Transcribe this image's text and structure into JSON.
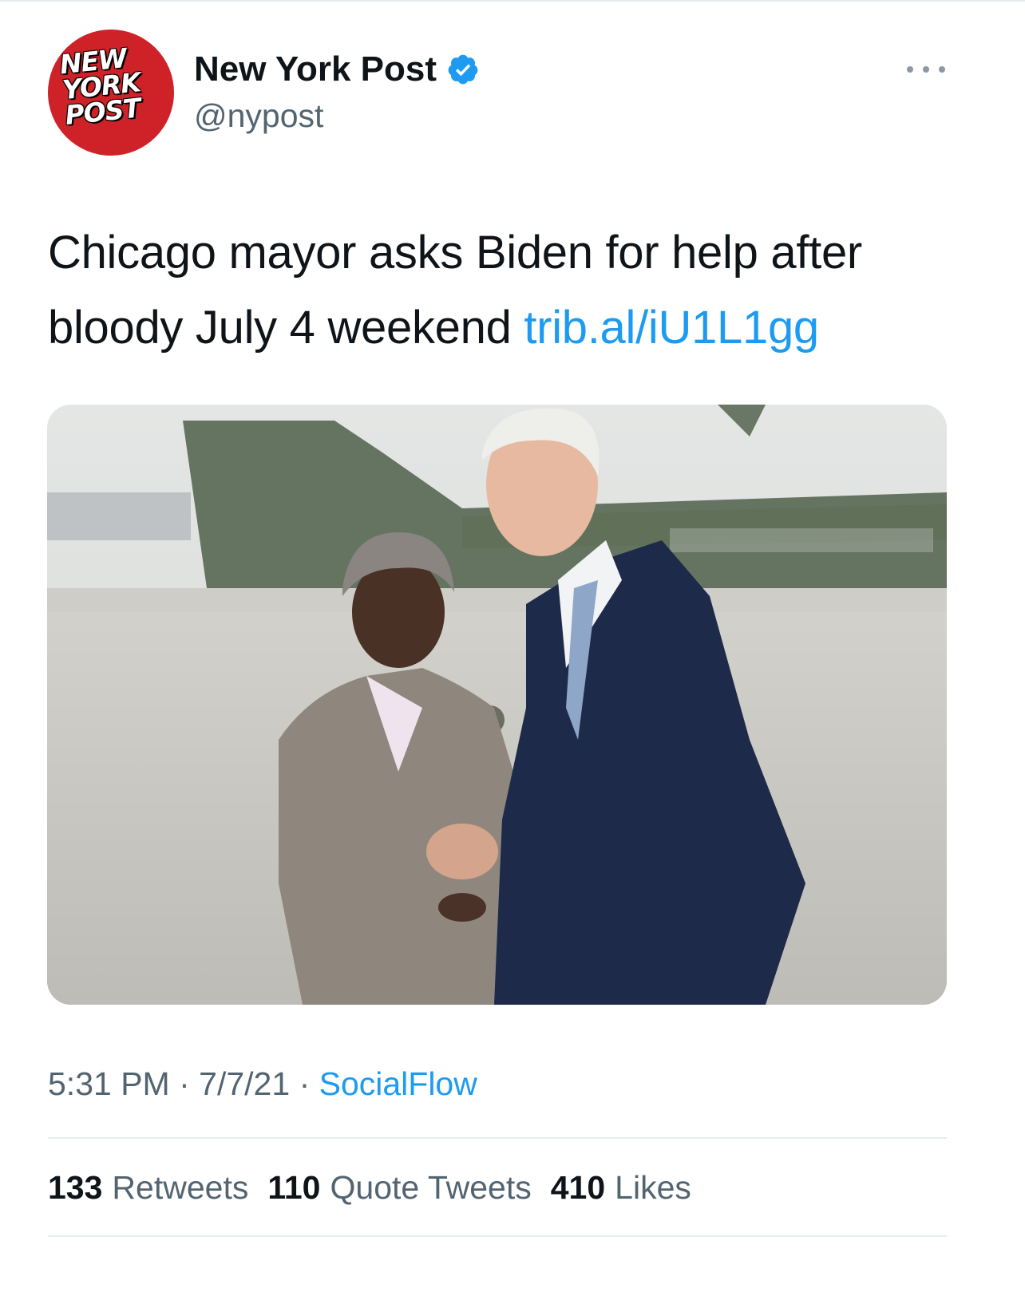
{
  "tweet": {
    "author": {
      "display_name": "New York Post",
      "handle": "@nypost",
      "verified": true,
      "avatar_logo_lines": [
        "NEW",
        "YORK",
        "POST"
      ],
      "avatar_color": "#cf2128"
    },
    "more_icon": "more-horizontal-icon",
    "text": "Chicago mayor asks Biden for help after bloody July 4 weekend",
    "link": "trib.al/iU1L1gg",
    "time": "5:31 PM",
    "date": "7/7/21",
    "source": "SocialFlow",
    "stats": {
      "retweets_count": "133",
      "retweets_label": "Retweets",
      "quotes_count": "110",
      "quotes_label": "Quote Tweets",
      "likes_count": "410",
      "likes_label": "Likes"
    }
  },
  "colors": {
    "link": "#1d9bf0",
    "secondary_text": "#536471",
    "primary_text": "#0f1419",
    "divider": "#e6ecf0"
  }
}
